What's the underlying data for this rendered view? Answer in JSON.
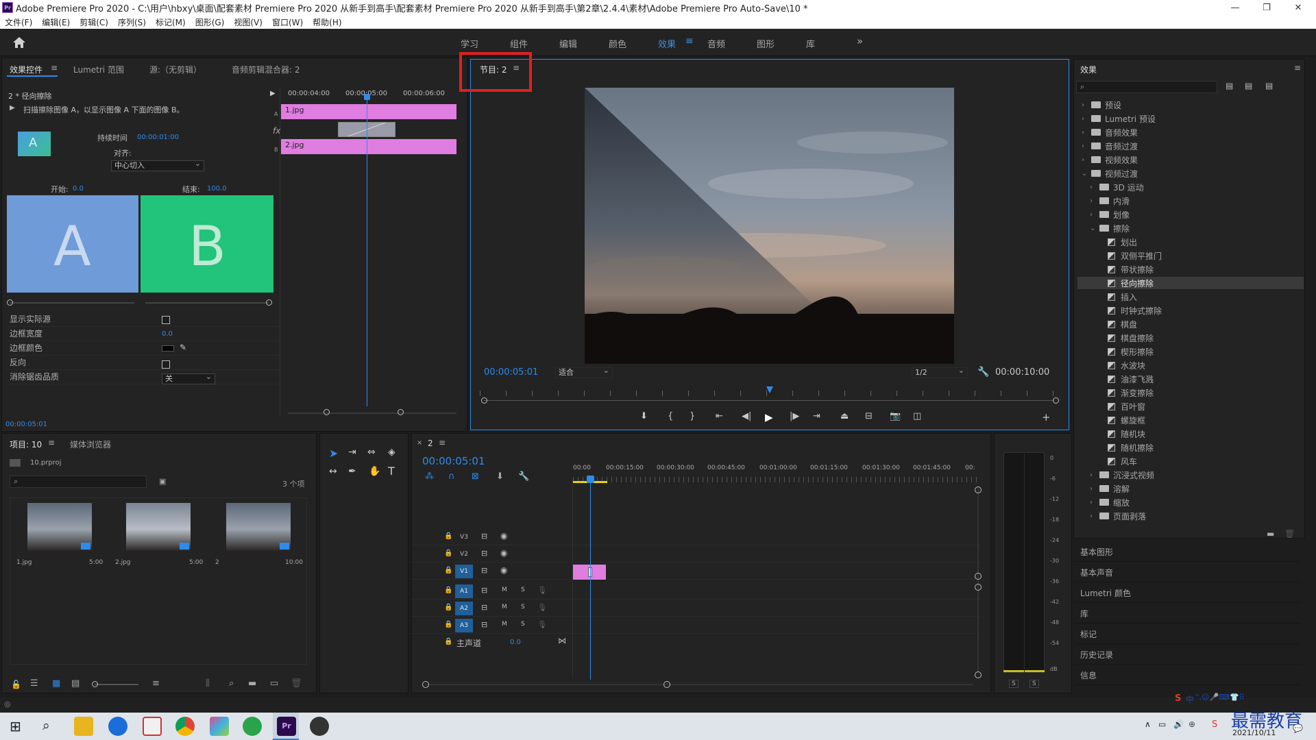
{
  "window": {
    "title": "Adobe Premiere Pro 2020 - C:\\用户\\hbxy\\桌面\\配套素材 Premiere Pro 2020 从新手到高手\\配套素材 Premiere Pro 2020 从新手到高手\\第2章\\2.4.4\\素材\\Adobe Premiere Pro Auto-Save\\10 *",
    "app_icon": "Pr",
    "minimize": "—",
    "maximize": "❐",
    "close": "✕"
  },
  "menu": [
    "文件(F)",
    "编辑(E)",
    "剪辑(C)",
    "序列(S)",
    "标记(M)",
    "图形(G)",
    "视图(V)",
    "窗口(W)",
    "帮助(H)"
  ],
  "workspaces": {
    "tabs": [
      "学习",
      "组件",
      "编辑",
      "颜色",
      "效果",
      "音频",
      "图形",
      "库"
    ],
    "active": "效果",
    "more": "»"
  },
  "effect_controls": {
    "tabs": [
      "效果控件",
      "Lumetri 范围",
      "源:（无剪辑）",
      "音频剪辑混合器: 2"
    ],
    "clip": "2 * 径向擦除",
    "description": "扫描擦除图像 A，以显示图像 A 下面的图像 B。",
    "duration_label": "持续时间",
    "duration": "00:00:01:00",
    "align_label": "对齐:",
    "align_value": "中心切入",
    "start_label": "开始:",
    "start_value": "0.0",
    "end_label": "结束:",
    "end_value": "100.0",
    "preview_a": "A",
    "preview_b": "B",
    "mini_timeline": {
      "times": [
        "00:00:04:00",
        "00:00:05:00",
        "00:00:06:00"
      ],
      "clip_a": "1.jpg",
      "clip_b": "2.jpg",
      "track_a": "A",
      "track_b": "B",
      "fx": "fx"
    },
    "props": [
      {
        "label": "显示实际源",
        "type": "checkbox"
      },
      {
        "label": "边框宽度",
        "type": "value",
        "value": "0.0"
      },
      {
        "label": "边框颜色",
        "type": "color"
      },
      {
        "label": "反向",
        "type": "checkbox"
      },
      {
        "label": "消除锯齿品质",
        "type": "select",
        "value": "关"
      }
    ],
    "timecode": "00:00:05:01"
  },
  "program": {
    "tab": "节目: 2",
    "timecode": "00:00:05:01",
    "fit": "适合",
    "resolution": "1/2",
    "duration": "00:00:10:00"
  },
  "project": {
    "tabs": [
      "项目: 10",
      "媒体浏览器"
    ],
    "file": "10.prproj",
    "count": "3 个项",
    "items": [
      {
        "name": "1.jpg",
        "dur": "5:00"
      },
      {
        "name": "2.jpg",
        "dur": "5:00"
      },
      {
        "name": "2",
        "dur": "10:00"
      }
    ]
  },
  "timeline": {
    "tab": "2",
    "timecode": "00:00:05:01",
    "ruler": [
      "00:00",
      "00:00:15:00",
      "00:00:30:00",
      "00:00:45:00",
      "00:01:00:00",
      "00:01:15:00",
      "00:01:30:00",
      "00:01:45:00",
      "00:"
    ],
    "video_tracks": [
      "V3",
      "V2",
      "V1"
    ],
    "audio_tracks": [
      "A1",
      "A2",
      "A3"
    ],
    "master": {
      "label": "主声道",
      "value": "0.0"
    },
    "mute": "M",
    "solo": "S"
  },
  "meter": {
    "scale": [
      "0",
      "-6",
      "-12",
      "-18",
      "-24",
      "-30",
      "-36",
      "-42",
      "-48",
      "-54",
      "dB"
    ],
    "solo": [
      "S",
      "S"
    ]
  },
  "effects": {
    "title": "效果",
    "tree": [
      {
        "label": "预设",
        "level": 0,
        "kind": "folder",
        "open": false
      },
      {
        "label": "Lumetri 预设",
        "level": 0,
        "kind": "folder",
        "open": false
      },
      {
        "label": "音频效果",
        "level": 0,
        "kind": "folder",
        "open": false
      },
      {
        "label": "音频过渡",
        "level": 0,
        "kind": "folder",
        "open": false
      },
      {
        "label": "视频效果",
        "level": 0,
        "kind": "folder",
        "open": false
      },
      {
        "label": "视频过渡",
        "level": 0,
        "kind": "folder",
        "open": true
      },
      {
        "label": "3D 运动",
        "level": 1,
        "kind": "folder",
        "open": false
      },
      {
        "label": "内滑",
        "level": 1,
        "kind": "folder",
        "open": false
      },
      {
        "label": "划像",
        "level": 1,
        "kind": "folder",
        "open": false
      },
      {
        "label": "擦除",
        "level": 1,
        "kind": "folder",
        "open": true
      },
      {
        "label": "划出",
        "level": 2,
        "kind": "fx"
      },
      {
        "label": "双侧平推门",
        "level": 2,
        "kind": "fx"
      },
      {
        "label": "带状擦除",
        "level": 2,
        "kind": "fx"
      },
      {
        "label": "径向擦除",
        "level": 2,
        "kind": "fx",
        "selected": true
      },
      {
        "label": "插入",
        "level": 2,
        "kind": "fx"
      },
      {
        "label": "时钟式擦除",
        "level": 2,
        "kind": "fx"
      },
      {
        "label": "棋盘",
        "level": 2,
        "kind": "fx"
      },
      {
        "label": "棋盘擦除",
        "level": 2,
        "kind": "fx"
      },
      {
        "label": "楔形擦除",
        "level": 2,
        "kind": "fx"
      },
      {
        "label": "水波块",
        "level": 2,
        "kind": "fx"
      },
      {
        "label": "油漆飞溅",
        "level": 2,
        "kind": "fx"
      },
      {
        "label": "渐变擦除",
        "level": 2,
        "kind": "fx"
      },
      {
        "label": "百叶窗",
        "level": 2,
        "kind": "fx"
      },
      {
        "label": "螺旋框",
        "level": 2,
        "kind": "fx"
      },
      {
        "label": "随机块",
        "level": 2,
        "kind": "fx"
      },
      {
        "label": "随机擦除",
        "level": 2,
        "kind": "fx"
      },
      {
        "label": "风车",
        "level": 2,
        "kind": "fx"
      },
      {
        "label": "沉浸式视频",
        "level": 1,
        "kind": "folder",
        "open": false
      },
      {
        "label": "溶解",
        "level": 1,
        "kind": "folder",
        "open": false
      },
      {
        "label": "缩放",
        "level": 1,
        "kind": "folder",
        "open": false
      },
      {
        "label": "页面剥落",
        "level": 1,
        "kind": "folder",
        "open": false
      }
    ],
    "lower_panels": [
      "基本图形",
      "基本声音",
      "Lumetri 颜色",
      "库",
      "标记",
      "历史记录",
      "信息"
    ]
  },
  "taskbar": {
    "date": "2021/10/11",
    "watermark": "最需教育",
    "ime": "中"
  },
  "colors": {
    "accent": "#2d8ceb",
    "clip": "#e07de0",
    "highlight": "#e02020",
    "a_box": "#6f9bd8",
    "b_box": "#22c37a"
  }
}
